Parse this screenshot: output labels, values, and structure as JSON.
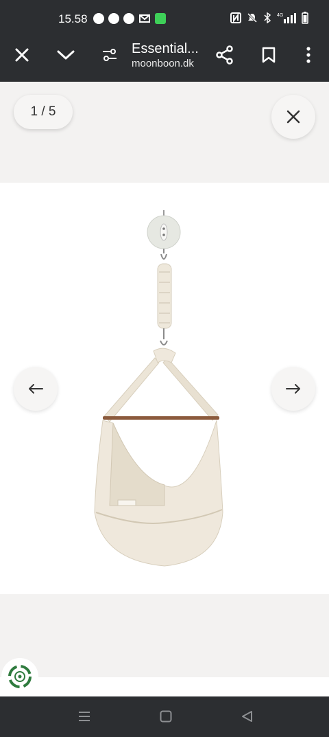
{
  "status_bar": {
    "time": "15.58",
    "notification_icons": [
      "facebook-icon",
      "facebook-icon",
      "messenger-icon",
      "gmail-icon",
      "android-app-icon"
    ],
    "system_icons": [
      "nfc-icon",
      "mute-icon",
      "bluetooth-icon",
      "signal-icon",
      "battery-icon"
    ],
    "network_label": "4G"
  },
  "toolbar": {
    "title": "Essential...",
    "domain": "moonboon.dk",
    "icons": [
      "close-icon",
      "chevron-down-icon",
      "page-settings-icon",
      "share-icon",
      "bookmark-icon",
      "more-vertical-icon"
    ]
  },
  "gallery": {
    "counter": "1 / 5",
    "current_image": 1,
    "total_images": 5,
    "icons": [
      "close-icon",
      "arrow-left-icon",
      "arrow-right-icon"
    ]
  },
  "bottom": {
    "badge_icon": "rotating-leaf-badge-icon"
  },
  "nav_bar": {
    "icons": [
      "recent-apps-icon",
      "home-icon",
      "back-icon"
    ]
  },
  "colors": {
    "bar_background": "#2c2e31",
    "gallery_background": "#f3f2f1",
    "product_background": "#ffffff",
    "fabric": "#efe8dc",
    "badge_green": "#2f7b3e"
  }
}
